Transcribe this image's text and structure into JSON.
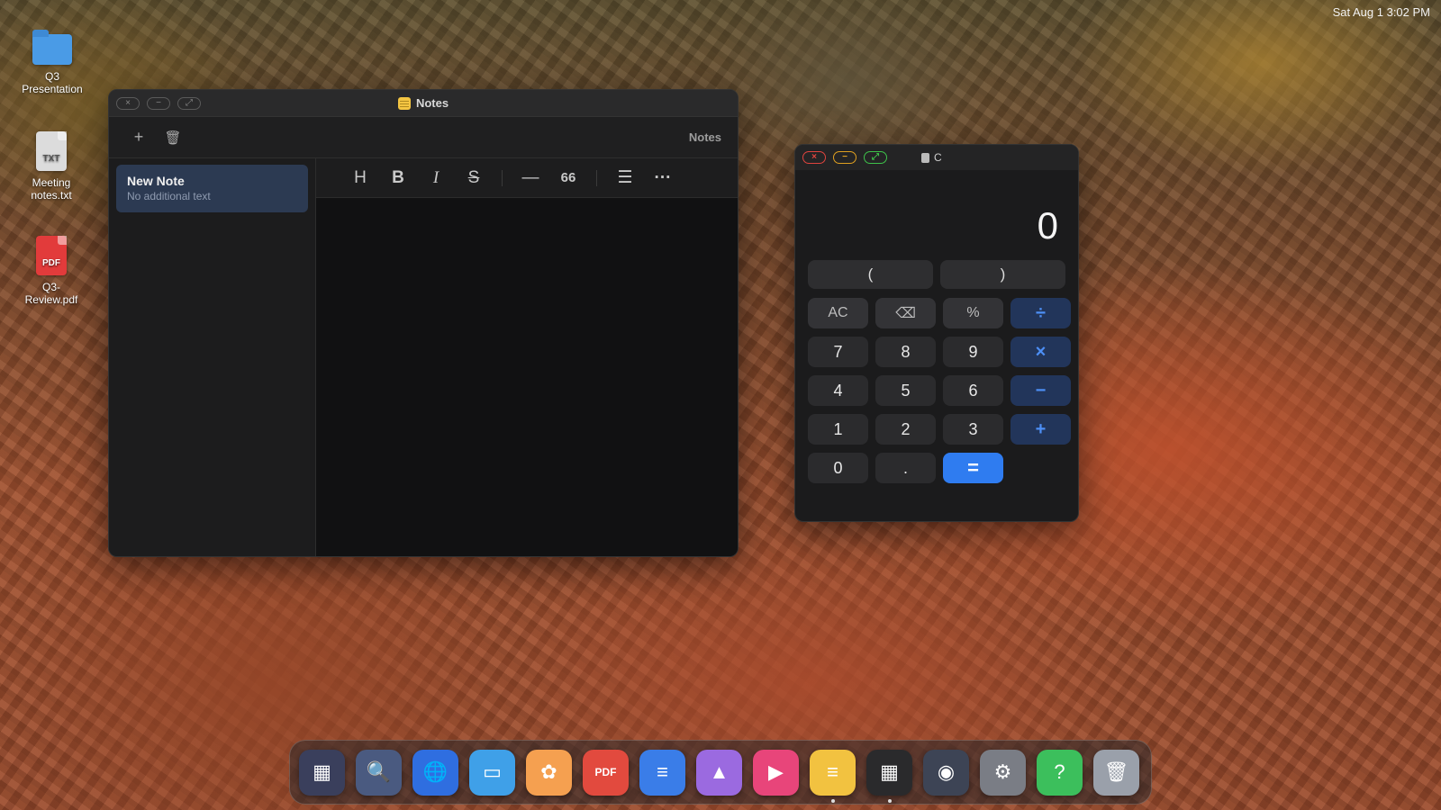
{
  "menubar": {
    "clock": "Sat Aug 1  3:02 PM"
  },
  "desktop": {
    "icons": [
      {
        "label": "Q3\nPresentation",
        "kind": "folder-icon"
      },
      {
        "label": "Meeting\nnotes.txt",
        "kind": "txt-file-icon",
        "badge": "TXT"
      },
      {
        "label": "Q3-\nReview.pdf",
        "kind": "pdf-file-icon",
        "badge": "PDF"
      }
    ]
  },
  "notes": {
    "title": "Notes",
    "breadcrumb": "Notes",
    "toolbar": {
      "new_icon": "+",
      "trash_icon": "🗑"
    },
    "list": [
      {
        "title": "New Note",
        "subtitle": "No additional text"
      }
    ],
    "format_buttons": {
      "heading": "H",
      "bold": "B",
      "italic": "I",
      "strike": "S",
      "rule": "—",
      "quote": "66",
      "list": "☰",
      "more": "···"
    }
  },
  "calculator": {
    "title_char": "C",
    "display": "0",
    "parens": [
      "(",
      ")"
    ],
    "keys": [
      "AC",
      "⌫",
      "%",
      "÷",
      "7",
      "8",
      "9",
      "×",
      "4",
      "5",
      "6",
      "−",
      "1",
      "2",
      "3",
      "+",
      "0",
      ".",
      "="
    ],
    "accent_color": "#2f7cf0"
  },
  "dock": {
    "apps": [
      {
        "name": "launchpad-icon",
        "glyph": "▦",
        "color": "#3a3f5c"
      },
      {
        "name": "search-icon",
        "glyph": "🔍",
        "color": "#4a5a80"
      },
      {
        "name": "browser-icon",
        "glyph": "🌐",
        "color": "#2f6ee0"
      },
      {
        "name": "files-icon",
        "glyph": "▭",
        "color": "#3fa0e8"
      },
      {
        "name": "photos-icon",
        "glyph": "✿",
        "color": "#f5a050"
      },
      {
        "name": "pdf-icon",
        "glyph": "PDF",
        "color": "#e24a3e"
      },
      {
        "name": "docs-icon",
        "glyph": "≡",
        "color": "#3a7de8"
      },
      {
        "name": "gallery-icon",
        "glyph": "▲",
        "color": "#9b6ae0"
      },
      {
        "name": "media-player-icon",
        "glyph": "▶",
        "color": "#e8457a"
      },
      {
        "name": "notes-app-icon",
        "glyph": "≡",
        "color": "#f2c240",
        "running": true
      },
      {
        "name": "calculator-icon",
        "glyph": "▦",
        "color": "#2a2a2c",
        "running": true
      },
      {
        "name": "camera-icon",
        "glyph": "◉",
        "color": "#3d4455"
      },
      {
        "name": "settings-icon",
        "glyph": "⚙",
        "color": "#7a7d85"
      },
      {
        "name": "help-icon",
        "glyph": "?",
        "color": "#3cbf5c"
      },
      {
        "name": "trash-icon",
        "glyph": "🗑",
        "color": "#9aa0aa"
      }
    ]
  }
}
